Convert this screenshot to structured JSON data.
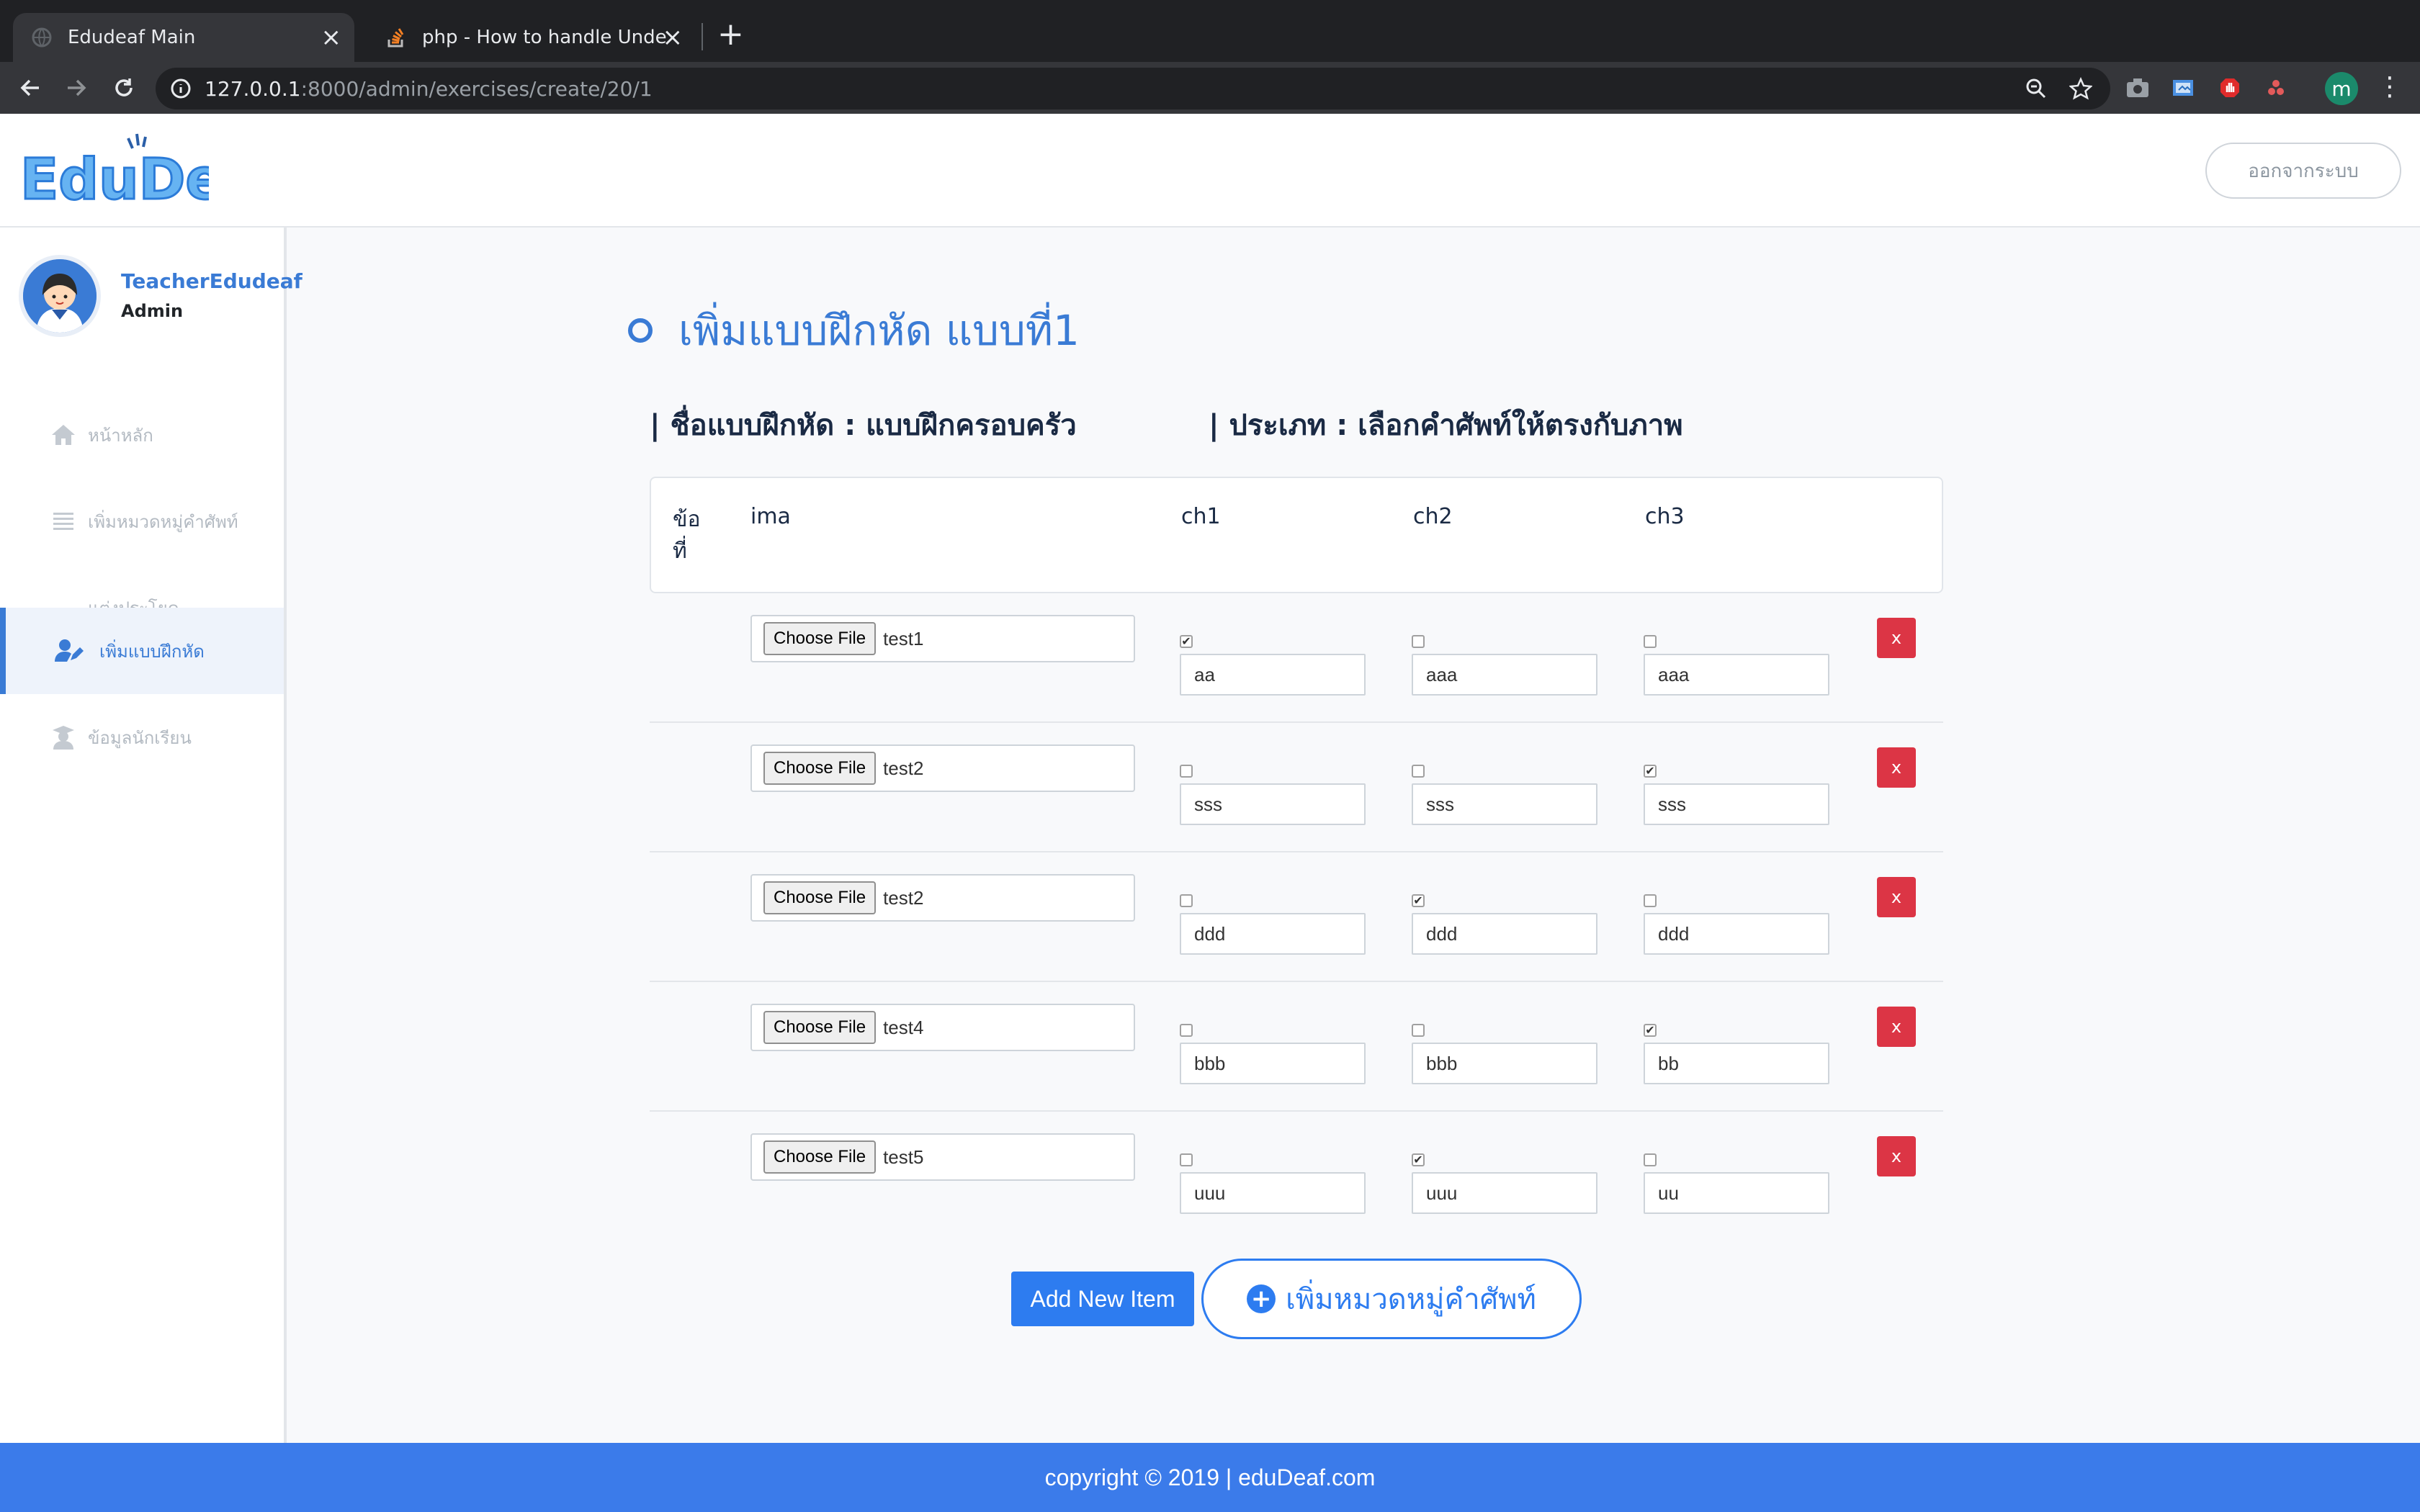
{
  "browser": {
    "tabs": [
      {
        "title": "Edudeaf Main",
        "active": true
      },
      {
        "title": "php - How to handle Undefined",
        "active": false
      }
    ],
    "url_host": "127.0.0.1",
    "url_rest": ":8000/admin/exercises/create/20/1",
    "profile_initial": "m"
  },
  "header": {
    "logo_text": "EduDeaf",
    "logout_label": "ออกจากระบบ"
  },
  "sidebar": {
    "user_name": "TeacherEdudeaf",
    "user_role": "Admin",
    "items": [
      {
        "label": "หน้าหลัก",
        "icon": "home-icon"
      },
      {
        "label": "เพิ่มหมวดหมู่คำศัพท์",
        "icon": "list-icon"
      },
      {
        "label": "แต่งประโยค",
        "icon": ""
      },
      {
        "label": "เพิ่มแบบฝึกหัด",
        "icon": "user-edit-icon"
      },
      {
        "label": "ข้อมูลนักเรียน",
        "icon": "graduate-icon"
      }
    ]
  },
  "main": {
    "title": "เพิ่มแบบฝึกหัด แบบที่1",
    "exercise_name": "| ชื่อแบบฝึกหัด : แบบฝึกครอบครัว",
    "exercise_type": "| ประเภท : เลือกคำศัพท์ให้ตรงกับภาพ",
    "columns": {
      "no_line1": "ข้อ",
      "no_line2": "ที่",
      "image": "ima",
      "ch1": "ch1",
      "ch2": "ch2",
      "ch3": "ch3"
    },
    "choose_file_label": "Choose File",
    "delete_label": "x",
    "rows": [
      {
        "file": "test1",
        "checked": [
          true,
          false,
          false
        ],
        "choices": [
          "aa",
          "aaa",
          "aaa"
        ]
      },
      {
        "file": "test2",
        "checked": [
          false,
          false,
          true
        ],
        "choices": [
          "sss",
          "sss",
          "sss"
        ]
      },
      {
        "file": "test2",
        "checked": [
          false,
          true,
          false
        ],
        "choices": [
          "ddd",
          "ddd",
          "ddd"
        ]
      },
      {
        "file": "test4",
        "checked": [
          false,
          false,
          true
        ],
        "choices": [
          "bbb",
          "bbb",
          "bb"
        ]
      },
      {
        "file": "test5",
        "checked": [
          false,
          true,
          false
        ],
        "choices": [
          "uuu",
          "uuu",
          "uu"
        ]
      }
    ],
    "add_item_label": "Add New Item",
    "add_category_label": "เพิ่มหมวดหมู่คำศัพท์"
  },
  "footer": {
    "text": "copyright © 2019 | eduDeaf.com"
  },
  "colors": {
    "accent": "#3a7bd5",
    "primary_button": "#2d7cf0",
    "danger": "#dc3545",
    "footer": "#3b7bea"
  }
}
